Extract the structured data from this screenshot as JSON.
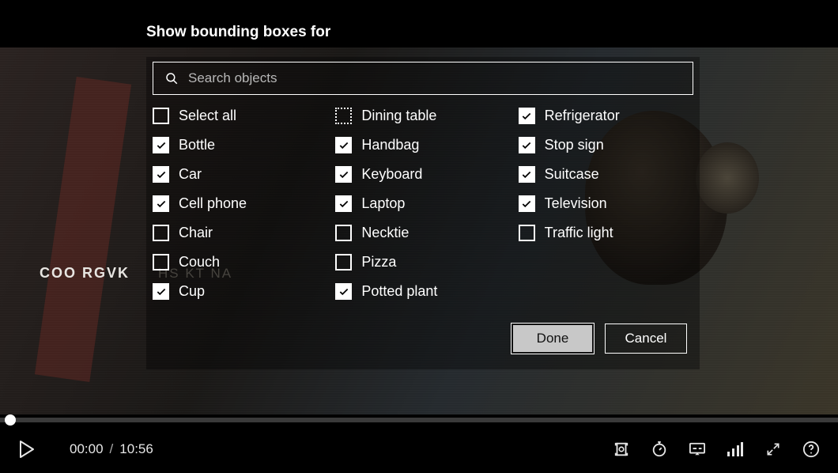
{
  "panel": {
    "title": "Show bounding boxes for",
    "search_placeholder": "Search objects",
    "select_all_label": "Select all",
    "select_all_state": "unchecked",
    "columns": [
      [
        {
          "label": "Bottle",
          "checked": true
        },
        {
          "label": "Car",
          "checked": true
        },
        {
          "label": "Cell phone",
          "checked": true
        },
        {
          "label": "Chair",
          "checked": false
        },
        {
          "label": "Couch",
          "checked": false
        },
        {
          "label": "Cup",
          "checked": true
        }
      ],
      [
        {
          "label": "Dining table",
          "checked": false,
          "indeterminate": true
        },
        {
          "label": "Handbag",
          "checked": true
        },
        {
          "label": "Keyboard",
          "checked": true
        },
        {
          "label": "Laptop",
          "checked": true
        },
        {
          "label": "Necktie",
          "checked": false
        },
        {
          "label": "Pizza",
          "checked": false
        },
        {
          "label": "Potted plant",
          "checked": true
        }
      ],
      [
        {
          "label": "Refrigerator",
          "checked": true
        },
        {
          "label": "Stop sign",
          "checked": true
        },
        {
          "label": "Suitcase",
          "checked": true
        },
        {
          "label": "Television",
          "checked": true
        },
        {
          "label": "Traffic light",
          "checked": false
        }
      ]
    ],
    "done_label": "Done",
    "cancel_label": "Cancel"
  },
  "backdrop": {
    "overlay_text_1": "COO RGVK",
    "overlay_text_2": "HS KT NA"
  },
  "player": {
    "current_time": "00:00",
    "duration": "10:56",
    "separator": "/"
  }
}
